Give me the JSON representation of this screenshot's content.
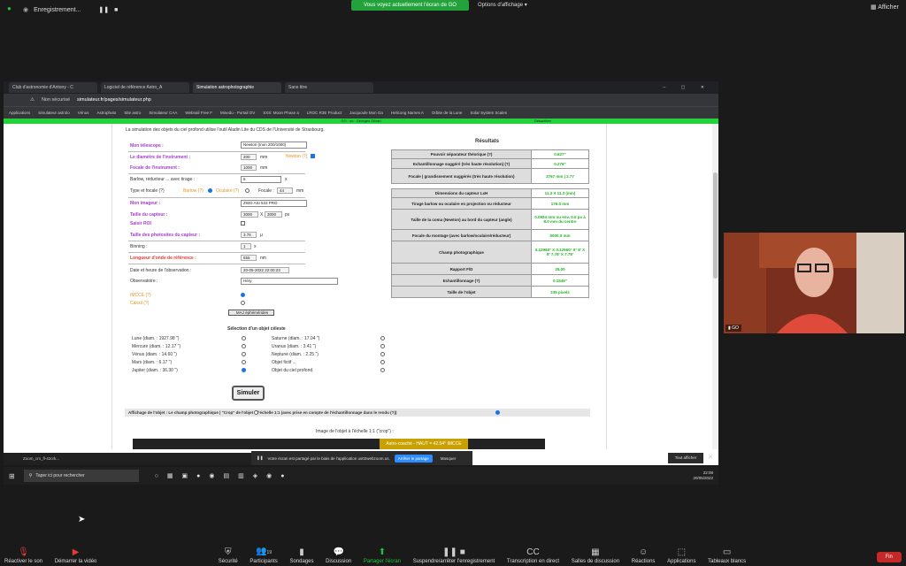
{
  "zoom_top": {
    "recording": "Enregistrement...",
    "share_banner": "Vous voyez actuellement l'écran de GO",
    "share_options": "Options d'affichage",
    "view": "Afficher"
  },
  "browser": {
    "tabs": [
      "Club d'astronomie d'Antony - C",
      "Logiciel de référence Astro_A",
      "Simulation astrophotographie",
      "Sans titre"
    ],
    "url_security": "Non sécurisé",
    "url": "simulateur.fr/pages/simulateur.php",
    "bookmarks": [
      "Applications",
      "simulateur astrolo",
      "Vénus",
      "Astrophoto",
      "Site astro",
      "Simulateur CAA",
      "Webnail Free F",
      "Minedu - Portail OV",
      "SXS: Moon Phase a",
      "LROC R3E Product",
      "Jacquoule Mon Ga",
      "Helicong Names A",
      "Orbite de la Lune",
      "Solar System Scales"
    ],
    "green_strip": "GO : ou : Georges Olivari",
    "green_right": "Désactiver"
  },
  "page": {
    "intro": "La simulation des objets du ciel profond utilise l'outil Aladin Lite du CDS de l'Université de Strasbourg.",
    "telescope_label": "Mon télescope :",
    "telescope_value": "Newton (Inon 200/1000)",
    "diametre_label": "Le diamètre de l'instrument :",
    "diametre_value": "200",
    "mm": "mm",
    "newton_label": "Newton (?)",
    "focale_label": "Focale de l'instrument :",
    "focale_value": "1000",
    "barlow_label": "Barlow, réducteur ... avec tirage :",
    "barlow_value": "5",
    "x": "x",
    "type_label": "Type et focale (?)",
    "barlow_opt": "Barlow (?)",
    "oculaire_opt": "Oculaire (?)",
    "focale_short": "Focale :",
    "focale_short_value": "44",
    "mm2": "mm",
    "imageur_label": "Mon imageur :",
    "imageur_value": "ZWO ASI 533 PRO",
    "capteur_label": "Taille du capteur :",
    "capteur_w": "3000",
    "capteur_x": "X",
    "capteur_h": "3000",
    "px": "px",
    "roi_label": "Saisir ROI",
    "photosites_label": "Taille des photosites du capteur :",
    "photosites_value": "3.76",
    "micron": "µ",
    "binning_label": "Binning :",
    "binning_value": "1",
    "longueur_label": "Longueur d'onde de référence :",
    "longueur_value": "555",
    "nm": "nm",
    "date_label": "Date et heure de l'observation :",
    "date_value": "20-05-2022 22:00:23",
    "observatoire_label": "Observatoire :",
    "observatoire_value": "Héry",
    "imcce": "IMCCE (?)",
    "calcul": "Calcul (?)",
    "maj": "MAJ éphémérides",
    "selection_title": "Sélection d'un objet céleste",
    "objects_left": [
      "Lune (diam. : 1927.98 \")",
      "Mercure (diam. : 12.17 \")",
      "Vénus (diam. : 14.60 \")",
      "Mars (diam. : 6.17 \")",
      "Jupiter (diam. : 36.30 \")"
    ],
    "objects_right": [
      "Saturne (diam. : 17.04 \")",
      "Uranus (diam. : 3.41 \")",
      "Neptune (diam. : 2.25 \")",
      "Objet fictif ...",
      "Objet du ciel profond"
    ],
    "simuler": "Simuler",
    "affichage": "Affichage de l'objet :    Le champ photographique     |     \"Crop\" de l'objet à l'échelle 1:1 (avec prise en compte de l'échantillonnage dans le rendu (?))",
    "image_caption": "Image de l'objet à l'échelle 1:1 (\"crop\") :",
    "crop_text": "Astro-coaché - HAUT = 42.54°   IMCCE"
  },
  "results": {
    "title": "Résultats",
    "rows": [
      {
        "k": "Pouvoir séparateur théorique (?)",
        "v": "0.627\""
      },
      {
        "k": "Echantillonnage suggéré (très haute résolution) (?)",
        "v": "0.276\""
      },
      {
        "k": "Focale | grandissement suggérés (très haute résolution)",
        "v": "2767 mm | 2.77"
      },
      {
        "k": "Dimensions du capteur LxH",
        "v": "11.3 X 11.3 (mm)"
      },
      {
        "k": "Tirage barlow ou oculaire en projection ou réducteur",
        "v": "176.0 mm"
      },
      {
        "k": "Taille de la coma (Newton) au bord du capteur (angle)",
        "v": "0.0924 mm ou env. 0.5 px à 8.0 mm du centre"
      },
      {
        "k": "Focale du montage (avec barlow/oculaire/réducteur)",
        "v": "5000.0 mm"
      },
      {
        "k": "Champ photographique",
        "v": "0.12960° X 0.12960° 0° 8' X 8' 7.78' X 7.78'"
      },
      {
        "k": "Rapport F/D",
        "v": "25.00"
      },
      {
        "k": "Echantillonnage (?)",
        "v": "0.1549\""
      },
      {
        "k": "Taille de l'objet",
        "v": "235 pixels"
      }
    ]
  },
  "windows": {
    "zoom_task": "Zoom_cm_fl-42crk...",
    "notif_text": "Votre écran est partagé par le biais de l'application us02webzoom.us.",
    "stop_share": "Arrêter le partage",
    "hide": "Masquer",
    "show_all": "Tout afficher",
    "search": "Taper ici pour rechercher",
    "time": "22:08",
    "date": "20/05/2022"
  },
  "participant": {
    "name": "GO"
  },
  "controls": [
    {
      "label": "Réactiver le son",
      "icon": "mic-off-icon"
    },
    {
      "label": "Démarrer la vidéo",
      "icon": "video-off-icon"
    },
    {
      "label": "Sécurité",
      "icon": "shield-icon"
    },
    {
      "label": "Participants",
      "icon": "people-icon",
      "count": "19"
    },
    {
      "label": "Sondages",
      "icon": "poll-icon"
    },
    {
      "label": "Discussion",
      "icon": "chat-icon"
    },
    {
      "label": "Partager l'écran",
      "icon": "share-icon"
    },
    {
      "label": "Suspendre/arrêter l'enregistrement",
      "icon": "pause-stop-icon"
    },
    {
      "label": "Transcription en direct",
      "icon": "cc-icon"
    },
    {
      "label": "Salles de discussion",
      "icon": "rooms-icon"
    },
    {
      "label": "Réactions",
      "icon": "reaction-icon"
    },
    {
      "label": "Applications",
      "icon": "apps-icon"
    },
    {
      "label": "Tableaux blancs",
      "icon": "whiteboard-icon"
    }
  ],
  "end": "Fin"
}
